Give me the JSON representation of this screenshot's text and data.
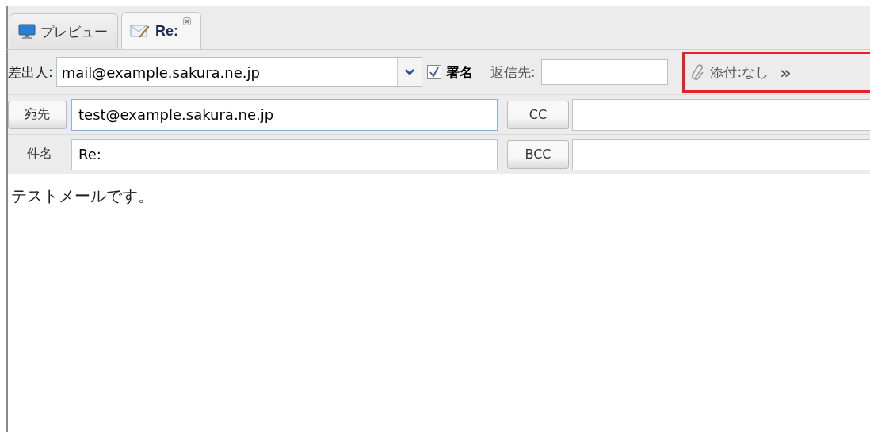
{
  "tabs": [
    {
      "label": "プレビュー",
      "kind": "preview",
      "selected": false,
      "closable": false
    },
    {
      "label": "Re:",
      "kind": "compose",
      "selected": true,
      "closable": true
    }
  ],
  "from": {
    "label": "差出人:",
    "value": "mail@example.sakura.ne.jp"
  },
  "signature": {
    "label": "署名",
    "checked": true
  },
  "reply_to": {
    "label": "返信先:"
  },
  "attachments": {
    "label": "添付:なし",
    "expand": "»",
    "highlighted": true
  },
  "to": {
    "label": "宛先",
    "value": "test@example.sakura.ne.jp"
  },
  "cc": {
    "label": "CC"
  },
  "subject": {
    "label": "件名",
    "value": "Re:"
  },
  "bcc": {
    "label": "BCC"
  },
  "body": "テストメールです。"
}
